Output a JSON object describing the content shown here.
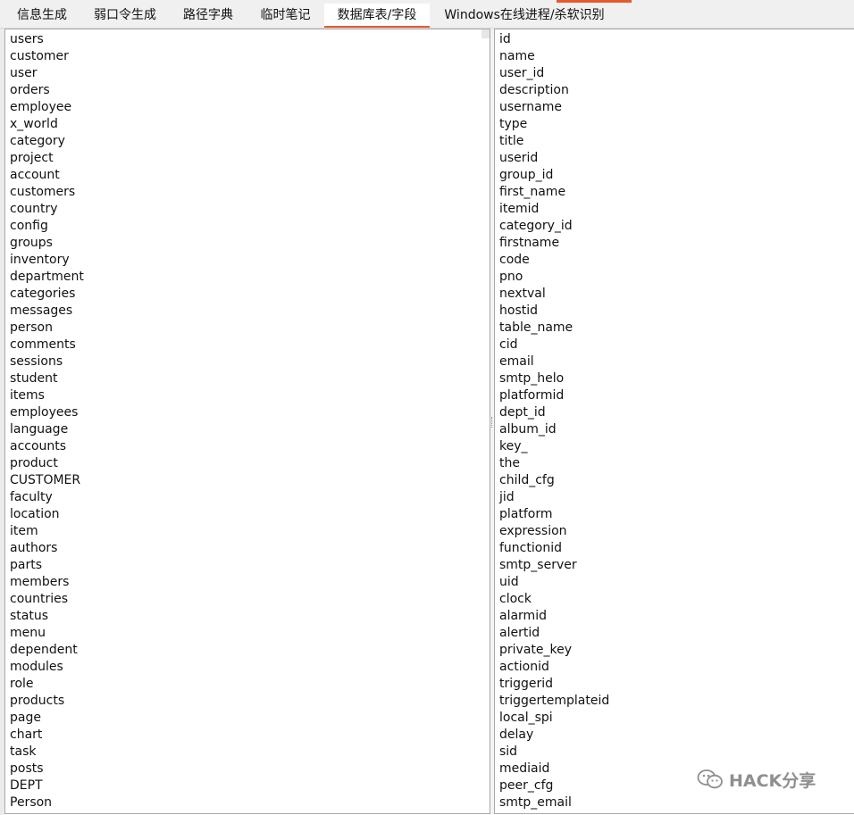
{
  "tabs": [
    {
      "label": "信息生成"
    },
    {
      "label": "弱口令生成"
    },
    {
      "label": "路径字典"
    },
    {
      "label": "临时笔记"
    },
    {
      "label": "数据库表/字段"
    },
    {
      "label": "Windows在线进程/杀软识别"
    }
  ],
  "active_tab": "数据库表/字段",
  "tables": [
    "users",
    "customer",
    "user",
    "orders",
    "employee",
    "x_world",
    "category",
    "project",
    "account",
    "customers",
    "country",
    "config",
    "groups",
    "inventory",
    "department",
    "categories",
    "messages",
    "person",
    "comments",
    "sessions",
    "student",
    "items",
    "employees",
    "language",
    "accounts",
    "product",
    "CUSTOMER",
    "faculty",
    "location",
    "item",
    "authors",
    "parts",
    "members",
    "countries",
    "status",
    "menu",
    "dependent",
    "modules",
    "role",
    "products",
    "page",
    "chart",
    "task",
    "posts",
    "DEPT",
    "Person"
  ],
  "fields": [
    "id",
    "name",
    "user_id",
    "description",
    "username",
    "type",
    "title",
    "userid",
    "group_id",
    "first_name",
    "itemid",
    "category_id",
    "firstname",
    "code",
    "pno",
    "nextval",
    "hostid",
    "table_name",
    "cid",
    "email",
    "smtp_helo",
    "platformid",
    "dept_id",
    "album_id",
    "key_",
    "the",
    "child_cfg",
    "jid",
    "platform",
    "expression",
    "functionid",
    "smtp_server",
    "uid",
    "clock",
    "alarmid",
    "alertid",
    "private_key",
    "actionid",
    "triggerid",
    "triggertemplateid",
    "local_spi",
    "delay",
    "sid",
    "mediaid",
    "peer_cfg",
    "smtp_email"
  ],
  "watermark": {
    "text": "HACK分享",
    "icon": "wechat-icon",
    "color": "#8f8f8f"
  },
  "colors": {
    "accent": "#e8582f",
    "border": "#a9a9a9",
    "tabbar_bg": "#f0f0f0"
  }
}
